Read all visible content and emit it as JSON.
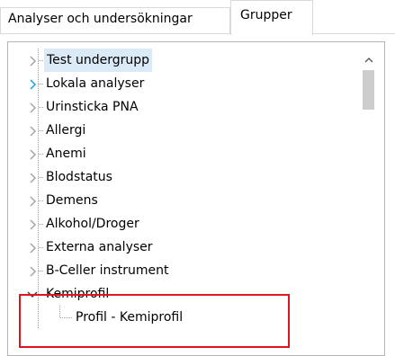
{
  "tabs": {
    "inactive_label": "Analyser och undersökningar",
    "active_label": "Grupper"
  },
  "tree": {
    "items": [
      {
        "label": "Test undergrupp",
        "state": "collapsed",
        "selected": true
      },
      {
        "label": "Lokala analyser",
        "state": "collapsed-hover"
      },
      {
        "label": "Urinsticka PNA",
        "state": "collapsed"
      },
      {
        "label": "Allergi",
        "state": "collapsed"
      },
      {
        "label": "Anemi",
        "state": "collapsed"
      },
      {
        "label": "Blodstatus",
        "state": "collapsed"
      },
      {
        "label": "Demens",
        "state": "collapsed"
      },
      {
        "label": "Alkohol/Droger",
        "state": "collapsed"
      },
      {
        "label": "Externa analyser",
        "state": "collapsed"
      },
      {
        "label": "B-Celler instrument",
        "state": "collapsed"
      },
      {
        "label": "Kemiprofil",
        "state": "expanded"
      }
    ],
    "child": {
      "label": "Profil - Kemiprofil"
    }
  },
  "colors": {
    "highlight_box": "#e3131b",
    "selection": "#dbeaf7",
    "hover_chevron": "#1ba1e2",
    "chevron": "#a6a6a6"
  },
  "icons": {
    "collapsed": "chevron-right-icon",
    "expanded": "chevron-down-icon",
    "scroll_up": "caret-up-icon"
  }
}
